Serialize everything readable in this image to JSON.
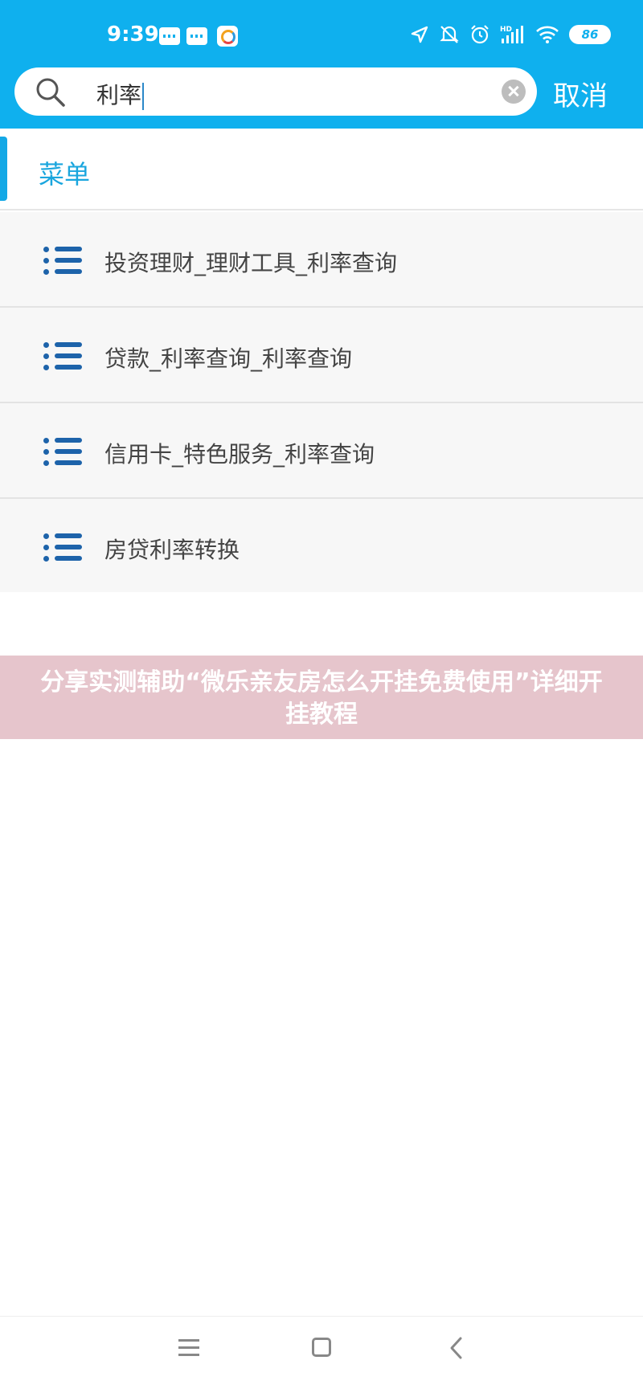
{
  "status_bar": {
    "time": "9:39",
    "battery": "86",
    "icons": [
      "message-icon",
      "message-icon",
      "app-notification-icon",
      "location-icon",
      "mute-icon",
      "alarm-icon",
      "hd-signal-icon",
      "wifi-icon",
      "battery-icon"
    ]
  },
  "search": {
    "query": "利率",
    "cancel_label": "取消"
  },
  "section": {
    "title": "菜单"
  },
  "menu_items": [
    {
      "label": "投资理财_理财工具_利率查询"
    },
    {
      "label": "贷款_利率查询_利率查询"
    },
    {
      "label": "信用卡_特色服务_利率查询"
    },
    {
      "label": "房贷利率转换"
    }
  ],
  "banner": {
    "text": "分享实测辅助“微乐亲友房怎么开挂免费使用”详细开挂教程"
  },
  "colors": {
    "accent": "#0fb0ee",
    "section_title": "#1aa6de",
    "list_icon": "#1d63aa",
    "banner_bg": "#e6c5cc"
  }
}
